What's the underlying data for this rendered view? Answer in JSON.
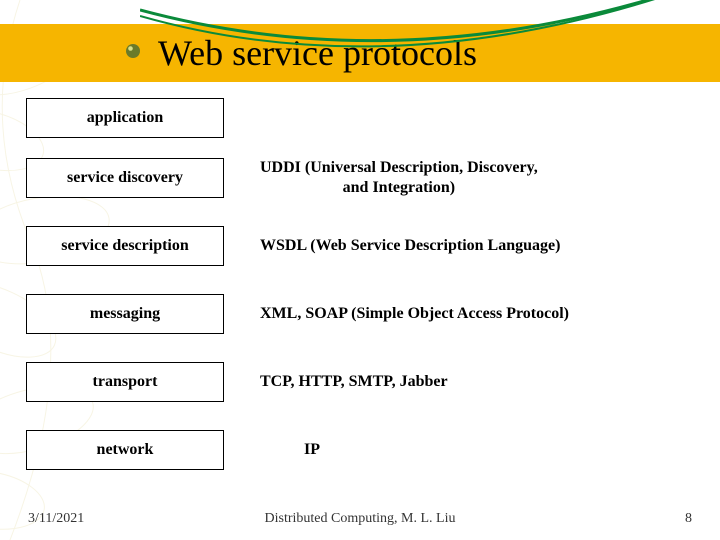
{
  "title": "Web service protocols",
  "layers": [
    {
      "name": "application",
      "desc": ""
    },
    {
      "name": "service discovery",
      "desc": "UDDI (Universal Description, Discovery,\nand Integration)"
    },
    {
      "name": "service description",
      "desc": "WSDL (Web Service Description Language)"
    },
    {
      "name": "messaging",
      "desc": "XML, SOAP (Simple Object Access Protocol)"
    },
    {
      "name": "transport",
      "desc": "TCP, HTTP, SMTP, Jabber"
    },
    {
      "name": "network",
      "desc": "IP"
    }
  ],
  "footer": {
    "date": "3/11/2021",
    "center": "Distributed Computing, M. L. Liu",
    "page": "8"
  }
}
